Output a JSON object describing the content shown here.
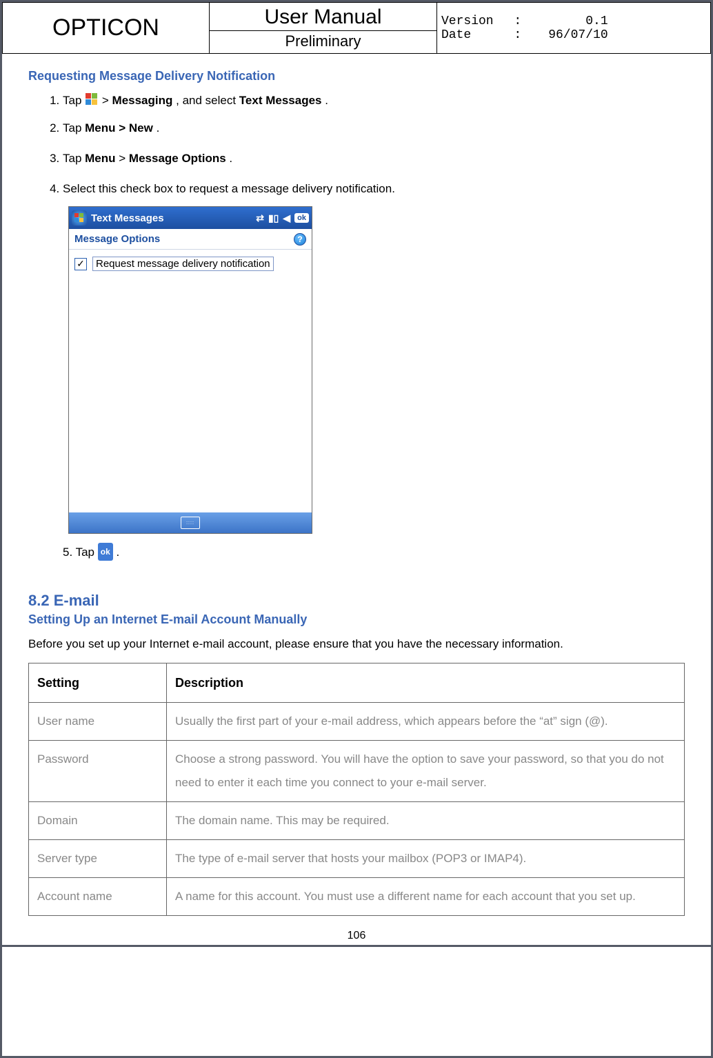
{
  "header": {
    "brand": "OPTICON",
    "title": "User Manual",
    "subtitle": "Preliminary",
    "version_label": "Version",
    "version_value": "0.1",
    "date_label": "Date",
    "date_value": "96/07/10",
    "sep": ":"
  },
  "section1": {
    "heading": "Requesting Message Delivery Notification",
    "steps": {
      "s1a": "Tap ",
      "s1b": " > ",
      "s1c": "Messaging",
      "s1d": ", and select ",
      "s1e": "Text Messages",
      "s1f": ".",
      "s2a": "Tap ",
      "s2b": "Menu > New",
      "s2c": ".",
      "s3a": "Tap ",
      "s3b": "Menu",
      "s3c": " > ",
      "s3d": "Message Options",
      "s3e": ".",
      "s4": "Select this check box to request a message delivery notification.",
      "s5a": "5.    Tap ",
      "s5b": "."
    }
  },
  "screenshot": {
    "title": "Text Messages",
    "ok": "ok",
    "subbar": "Message Options",
    "checkbox_label": "Request message delivery notification",
    "checkmark": "✓",
    "help": "?",
    "signal": "▮▮",
    "antenna": "📶",
    "vol": "🔈",
    "kbd": "⌨"
  },
  "ok_badge": "ok",
  "section2": {
    "heading": "8.2 E-mail",
    "subheading": "Setting Up an Internet E-mail Account Manually",
    "intro": "Before you set up your Internet e-mail account, please ensure that you have the necessary information."
  },
  "table": {
    "h1": "Setting",
    "h2": "Description",
    "rows": [
      {
        "k": "User name",
        "v": "Usually the first part of your e-mail address, which appears before the “at” sign (@)."
      },
      {
        "k": "Password",
        "v": "Choose a strong password. You will have the option to save your password, so that you do not need to enter it each time you connect to your e-mail server."
      },
      {
        "k": "Domain",
        "v": "The domain name. This may be required."
      },
      {
        "k": "Server type",
        "v": "The type of e-mail server that hosts your mailbox (POP3 or IMAP4)."
      },
      {
        "k": "Account name",
        "v": "A name for this account. You must use a different name for each account that you set up."
      }
    ]
  },
  "page_number": "106"
}
